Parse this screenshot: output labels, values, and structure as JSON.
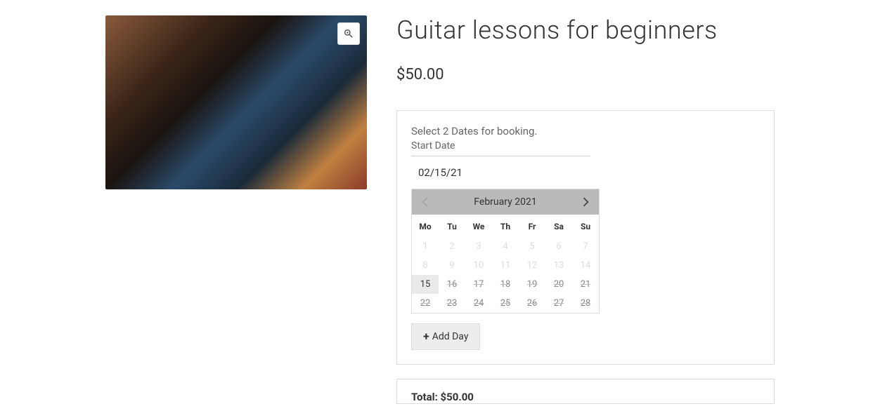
{
  "product": {
    "title": "Guitar lessons for beginners",
    "price": "$50.00"
  },
  "booking": {
    "prompt": "Select 2 Dates for booking.",
    "start_date_label": "Start Date",
    "start_date_value": "02/15/21",
    "add_day_label": "Add Day"
  },
  "calendar": {
    "month_label": "February 2021",
    "day_headers": [
      "Mo",
      "Tu",
      "We",
      "Th",
      "Fr",
      "Sa",
      "Su"
    ],
    "weeks": [
      [
        {
          "n": "1",
          "s": "disabled"
        },
        {
          "n": "2",
          "s": "disabled"
        },
        {
          "n": "3",
          "s": "disabled"
        },
        {
          "n": "4",
          "s": "disabled"
        },
        {
          "n": "5",
          "s": "disabled"
        },
        {
          "n": "6",
          "s": "disabled"
        },
        {
          "n": "7",
          "s": "disabled"
        }
      ],
      [
        {
          "n": "8",
          "s": "disabled"
        },
        {
          "n": "9",
          "s": "disabled"
        },
        {
          "n": "10",
          "s": "disabled"
        },
        {
          "n": "11",
          "s": "disabled"
        },
        {
          "n": "12",
          "s": "disabled"
        },
        {
          "n": "13",
          "s": "disabled"
        },
        {
          "n": "14",
          "s": "disabled"
        }
      ],
      [
        {
          "n": "15",
          "s": "selected"
        },
        {
          "n": "16",
          "s": "strike"
        },
        {
          "n": "17",
          "s": "strike"
        },
        {
          "n": "18",
          "s": "strike"
        },
        {
          "n": "19",
          "s": "strike"
        },
        {
          "n": "20",
          "s": "strike"
        },
        {
          "n": "21",
          "s": "strike"
        }
      ],
      [
        {
          "n": "22",
          "s": "strike"
        },
        {
          "n": "23",
          "s": "strike"
        },
        {
          "n": "24",
          "s": "strike"
        },
        {
          "n": "25",
          "s": "strike"
        },
        {
          "n": "26",
          "s": "strike"
        },
        {
          "n": "27",
          "s": "strike"
        },
        {
          "n": "28",
          "s": "strike"
        }
      ]
    ]
  },
  "total": {
    "label": "Total:",
    "value": "$50.00"
  }
}
